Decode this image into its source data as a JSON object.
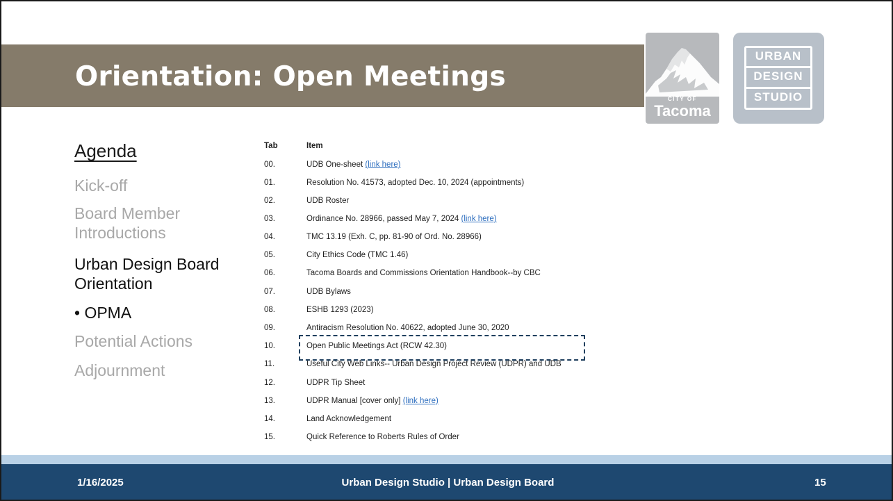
{
  "slide": {
    "title": "Orientation: Open Meetings"
  },
  "logos": {
    "tacoma": {
      "small": "CITY OF",
      "name": "Tacoma"
    },
    "uds": {
      "lines": [
        "URBAN",
        "DESIGN",
        "STUDIO"
      ]
    }
  },
  "agenda": {
    "heading": "Agenda",
    "items": [
      {
        "label": "Kick-off",
        "state": "inactive"
      },
      {
        "label": "Board Member",
        "state": "inactive"
      },
      {
        "label": "Introductions",
        "state": "inactive"
      },
      {
        "label": "Urban Design Board",
        "state": "active"
      },
      {
        "label": "Orientation",
        "state": "active"
      },
      {
        "label": "• OPMA",
        "state": "active"
      },
      {
        "label": "Potential Actions",
        "state": "inactive"
      },
      {
        "label": "Adjournment",
        "state": "inactive"
      }
    ]
  },
  "table": {
    "headers": {
      "tab": "Tab",
      "item": "Item"
    },
    "rows": [
      {
        "tab": "00.",
        "item": "UDB One-sheet ",
        "link": "(link here)"
      },
      {
        "tab": "01.",
        "item": "Resolution No. 41573, adopted Dec. 10, 2024 (appointments)",
        "link": ""
      },
      {
        "tab": "02.",
        "item": "UDB Roster",
        "link": ""
      },
      {
        "tab": "03.",
        "item": "Ordinance No. 28966, passed May 7, 2024 ",
        "link": "(link here)"
      },
      {
        "tab": "04.",
        "item": "TMC 13.19 (Exh. C, pp. 81-90 of Ord. No. 28966)",
        "link": ""
      },
      {
        "tab": "05.",
        "item": "City Ethics Code (TMC 1.46)",
        "link": ""
      },
      {
        "tab": "06.",
        "item": "Tacoma Boards and Commissions Orientation Handbook--by CBC",
        "link": ""
      },
      {
        "tab": "07.",
        "item": "UDB Bylaws",
        "link": ""
      },
      {
        "tab": "08.",
        "item": "ESHB 1293 (2023)",
        "link": ""
      },
      {
        "tab": "09.",
        "item": "Antiracism Resolution No. 40622, adopted June 30, 2020",
        "link": ""
      },
      {
        "tab": "10.",
        "item": "Open Public Meetings Act (RCW 42.30)",
        "link": ""
      },
      {
        "tab": "11.",
        "item": "Useful City Web Links-- Urban Design Project Review (UDPR) and UDB",
        "link": ""
      },
      {
        "tab": "12.",
        "item": "UDPR Tip Sheet",
        "link": ""
      },
      {
        "tab": "13.",
        "item": "UDPR Manual [cover only] ",
        "link": "(link here)"
      },
      {
        "tab": "14.",
        "item": "Land Acknowledgement",
        "link": ""
      },
      {
        "tab": "15.",
        "item": "Quick Reference to Roberts Rules of Order",
        "link": ""
      }
    ],
    "highlighted_row": "10."
  },
  "footer": {
    "date": "1/16/2025",
    "center": "Urban Design Studio | Urban Design Board",
    "page": "15"
  },
  "colors": {
    "title_band": "#857b6a",
    "footer": "#1e4870",
    "footer_accent": "#b9d1e6",
    "link": "#2f6fbf",
    "highlight_border": "#1f3f5e",
    "inactive_text": "#a8a8a8"
  }
}
